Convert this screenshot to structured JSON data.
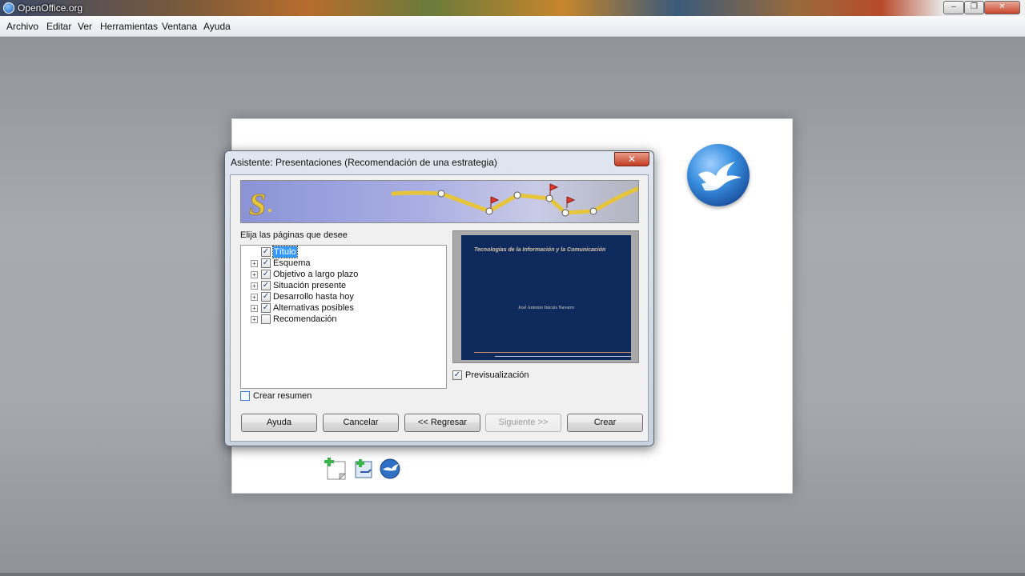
{
  "window": {
    "title": "OpenOffice.org",
    "controls": {
      "minimize": "–",
      "maximize": "❐",
      "close": "✕"
    }
  },
  "menubar": {
    "items": [
      "Archivo",
      "Editar",
      "Ver",
      "Herramientas",
      "Ventana",
      "Ayuda"
    ]
  },
  "dialog": {
    "title": "Asistente: Presentaciones (Recomendación de una estrategia)",
    "close_glyph": "✕",
    "choose_label": "Elija las páginas que desee",
    "pages": [
      {
        "label": "Título",
        "checked": true,
        "expandable": false,
        "selected": true
      },
      {
        "label": "Esquema",
        "checked": true,
        "expandable": true,
        "selected": false
      },
      {
        "label": "Objetivo a largo plazo",
        "checked": true,
        "expandable": true,
        "selected": false
      },
      {
        "label": "Situación presente",
        "checked": true,
        "expandable": true,
        "selected": false
      },
      {
        "label": "Desarrollo hasta hoy",
        "checked": true,
        "expandable": true,
        "selected": false
      },
      {
        "label": "Alternativas posibles",
        "checked": true,
        "expandable": true,
        "selected": false
      },
      {
        "label": "Recomendación",
        "checked": false,
        "expandable": true,
        "selected": false
      }
    ],
    "preview": {
      "slide_title": "Tecnologías de la Información y la Comunicación",
      "slide_author": "José Antonio Inicuis Navarro",
      "checkbox_label": "Previsualización",
      "checked": true
    },
    "summary": {
      "label": "Crear resumen",
      "checked": false
    },
    "buttons": {
      "help": "Ayuda",
      "cancel": "Cancelar",
      "back": "<< Regresar",
      "next": "Siguiente >>",
      "create": "Crear"
    }
  },
  "colors": {
    "slide_background": "#0e2a5c",
    "selection": "#3399ff",
    "close_button": "#c23a22"
  }
}
